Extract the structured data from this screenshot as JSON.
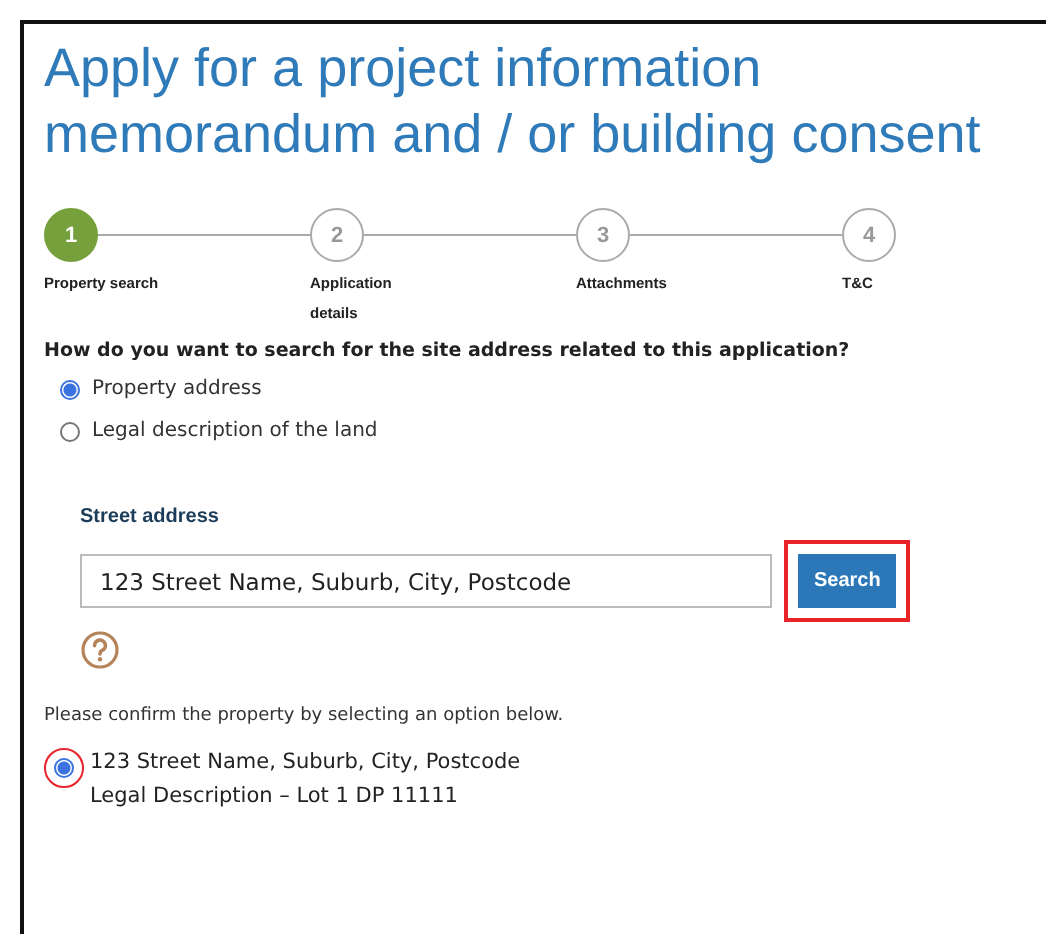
{
  "title": "Apply for a project information memorandum and / or building consent",
  "steps": [
    {
      "number": "1",
      "label": "Property search",
      "selected": true
    },
    {
      "number": "2",
      "label": "Application details",
      "selected": false
    },
    {
      "number": "3",
      "label": "Attachments",
      "selected": false
    },
    {
      "number": "4",
      "label": "T&C",
      "selected": false
    }
  ],
  "question": "How do you want to search for the site address related to this application?",
  "search_options": [
    {
      "label": "Property address",
      "selected": true
    },
    {
      "label": "Legal description of the land",
      "selected": false
    }
  ],
  "street_address": {
    "label": "Street address",
    "value": "123 Street Name, Suburb, City, Postcode",
    "button": "Search",
    "button_highlighted": true
  },
  "confirm_prompt": "Please confirm the property by selecting an option below.",
  "results": [
    {
      "address": "123 Street Name, Suburb, City, Postcode",
      "legal": "Legal Description – Lot 1 DP 11111",
      "selected": true,
      "highlighted": true
    }
  ]
}
